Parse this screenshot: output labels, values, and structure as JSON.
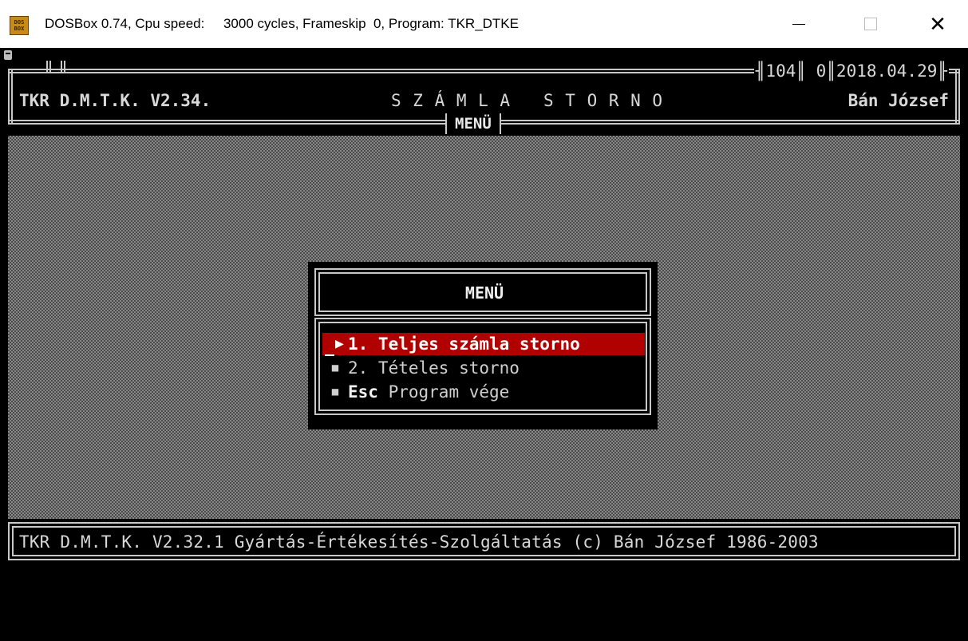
{
  "window": {
    "icon_text_top": "DOS",
    "icon_text_bottom": "BOX",
    "title": "DOSBox 0.74, Cpu speed:     3000 cycles, Frameskip  0, Program: TKR_DTKE",
    "minimize_glyph": "—",
    "close_glyph": "✕"
  },
  "header": {
    "stats": "╢104║ 0║2018.04.29╟",
    "app_version": "TKR D.M.T.K. V2.34.",
    "screen_title": "S Z Á M L A   S T O R N O",
    "user": "Bán József",
    "menu_tab": "MENÜ"
  },
  "dialog": {
    "title": "MENÜ",
    "items": [
      {
        "marker": "▶",
        "label": "1. Teljes számla storno",
        "selected": true
      },
      {
        "marker": "■",
        "label": "2. Tételes storno",
        "selected": false
      },
      {
        "marker": "■",
        "key": "Esc",
        "label": " Program vége",
        "selected": false
      }
    ]
  },
  "footer": {
    "text": "TKR D.M.T.K. V2.32.1 Gyártás-Értékesítés-Szolgáltatás (c) Bán József 1986-2003"
  },
  "colors": {
    "selection": "#b00000",
    "frame": "#c8c8c8",
    "screen_bg": "#000000"
  }
}
